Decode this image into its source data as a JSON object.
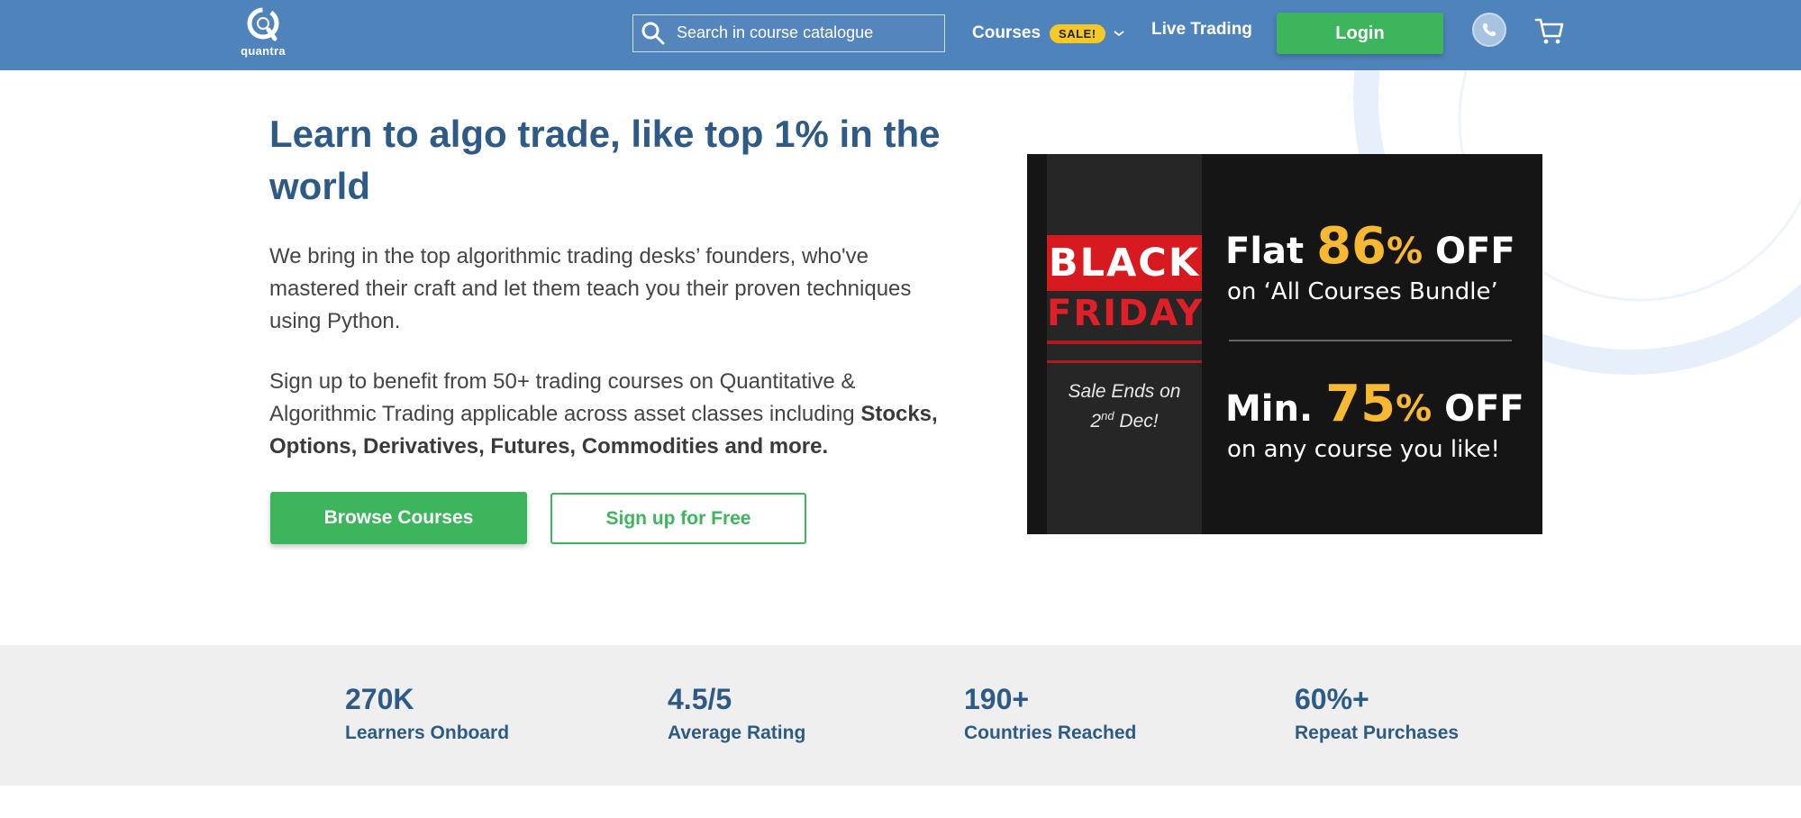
{
  "header": {
    "logo_text": "quantra",
    "search": {
      "placeholder": "Search in course catalogue",
      "value": ""
    },
    "nav": {
      "courses_label": "Courses",
      "sale_badge": "SALE!",
      "live_trading_label": "Live Trading"
    },
    "login_label": "Login",
    "icons": [
      "search-icon",
      "chevron-down-icon",
      "phone-icon",
      "cart-icon"
    ]
  },
  "hero": {
    "title": "Learn to algo trade, like top 1% in the world",
    "paragraph1": "We bring in the top algorithmic trading desks’ founders, who've mastered their craft and let them teach you their proven techniques using Python.",
    "paragraph2_lead": "Sign up to benefit from 50+ trading courses on Quantitative & Algorithmic Trading applicable across asset classes including ",
    "paragraph2_bold": "Stocks, Options, Derivatives, Futures, Commodities and more.",
    "browse_button": "Browse Courses",
    "signup_button": "Sign up for Free"
  },
  "banner": {
    "black": "BLACK",
    "friday": "FRIDAY",
    "sale_ends_line1": "Sale Ends on",
    "sale_ends_day": "2",
    "sale_ends_suffix": "nd",
    "sale_ends_month": " Dec!",
    "offer1_prefix": "Flat ",
    "offer1_number": "86",
    "offer1_percent": "%",
    "offer1_suffix": " OFF",
    "offer1_sub": "on ‘All Courses Bundle’",
    "offer2_prefix": "Min. ",
    "offer2_number": "75",
    "offer2_percent": "%",
    "offer2_suffix": " OFF",
    "offer2_sub": "on any course you like!",
    "colors": {
      "red": "#d71920",
      "yellow": "#f7b932",
      "background": "#151515"
    }
  },
  "stats": [
    {
      "value": "270K",
      "label": "Learners Onboard"
    },
    {
      "value": "4.5/5",
      "label": "Average Rating"
    },
    {
      "value": "190+",
      "label": "Countries Reached"
    },
    {
      "value": "60%+",
      "label": "Repeat Purchases"
    }
  ],
  "colors": {
    "header_bg": "#4f83bb",
    "brand_blue": "#2e5a86",
    "cta_green": "#3cb55d",
    "sale_yellow": "#f7c927",
    "stats_bg": "#efefef"
  }
}
